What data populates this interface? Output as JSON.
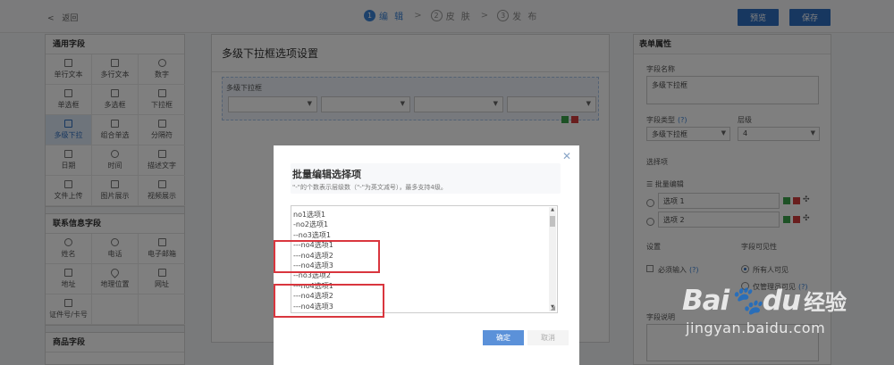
{
  "topbar": {
    "back": "返回",
    "steps": [
      {
        "num": "1",
        "label": "编 辑"
      },
      {
        "num": "2",
        "label": "皮 肤"
      },
      {
        "num": "3",
        "label": "发 布"
      }
    ],
    "preview": "预览",
    "save": "保存"
  },
  "left": {
    "sections": [
      {
        "title": "通用字段",
        "items": [
          "单行文本",
          "多行文本",
          "数字",
          "单选框",
          "多选框",
          "下拉框",
          "多级下拉",
          "组合单选",
          "分隔符",
          "日期",
          "时间",
          "描述文字",
          "文件上传",
          "图片展示",
          "视频展示"
        ]
      },
      {
        "title": "联系信息字段",
        "items": [
          "姓名",
          "电话",
          "电子邮箱",
          "地址",
          "地理位置",
          "网址",
          "证件号/卡号",
          "",
          ""
        ]
      },
      {
        "title": "商品字段",
        "items": []
      }
    ]
  },
  "center": {
    "title": "多级下拉框选项设置",
    "field_label": "多级下拉框"
  },
  "right": {
    "title": "表单属性",
    "field_name_label": "字段名称",
    "field_name_value": "多级下拉框",
    "field_type_label": "字段类型",
    "field_type_value": "多级下拉框",
    "level_label": "层级",
    "level_value": "4",
    "options_label": "选择项",
    "batch_edit": "批量编辑",
    "options": [
      "选项 1",
      "选项 2"
    ],
    "settings_label": "设置",
    "visibility_label": "字段可见性",
    "required_label": "必须输入",
    "visibility_value": "所有人可见",
    "visibility_other": "仅管理员可见",
    "desc_label": "字段说明",
    "help": "(?)"
  },
  "modal": {
    "title": "批量编辑选择项",
    "hint": "\"-\"的个数表示层级数（\"-\"为英文减号），最多支持4级。",
    "lines": [
      "no1选项1",
      "-no2选项1",
      "--no3选项1",
      "---no4选项1",
      "---no4选项2",
      "---no4选项3",
      "--no3选项2",
      "---no4选项1",
      "---no4选项2",
      "---no4选项3"
    ],
    "ok": "确定",
    "cancel": "取消"
  },
  "watermark": {
    "logo_bai": "Bai",
    "logo_du": "du",
    "logo_cn": "经验",
    "url": "jingyan.baidu.com"
  },
  "colors": {
    "primary": "#2f6fc0",
    "highlight": "#d9363e",
    "green": "#3aa24a",
    "red": "#d23c3c"
  }
}
